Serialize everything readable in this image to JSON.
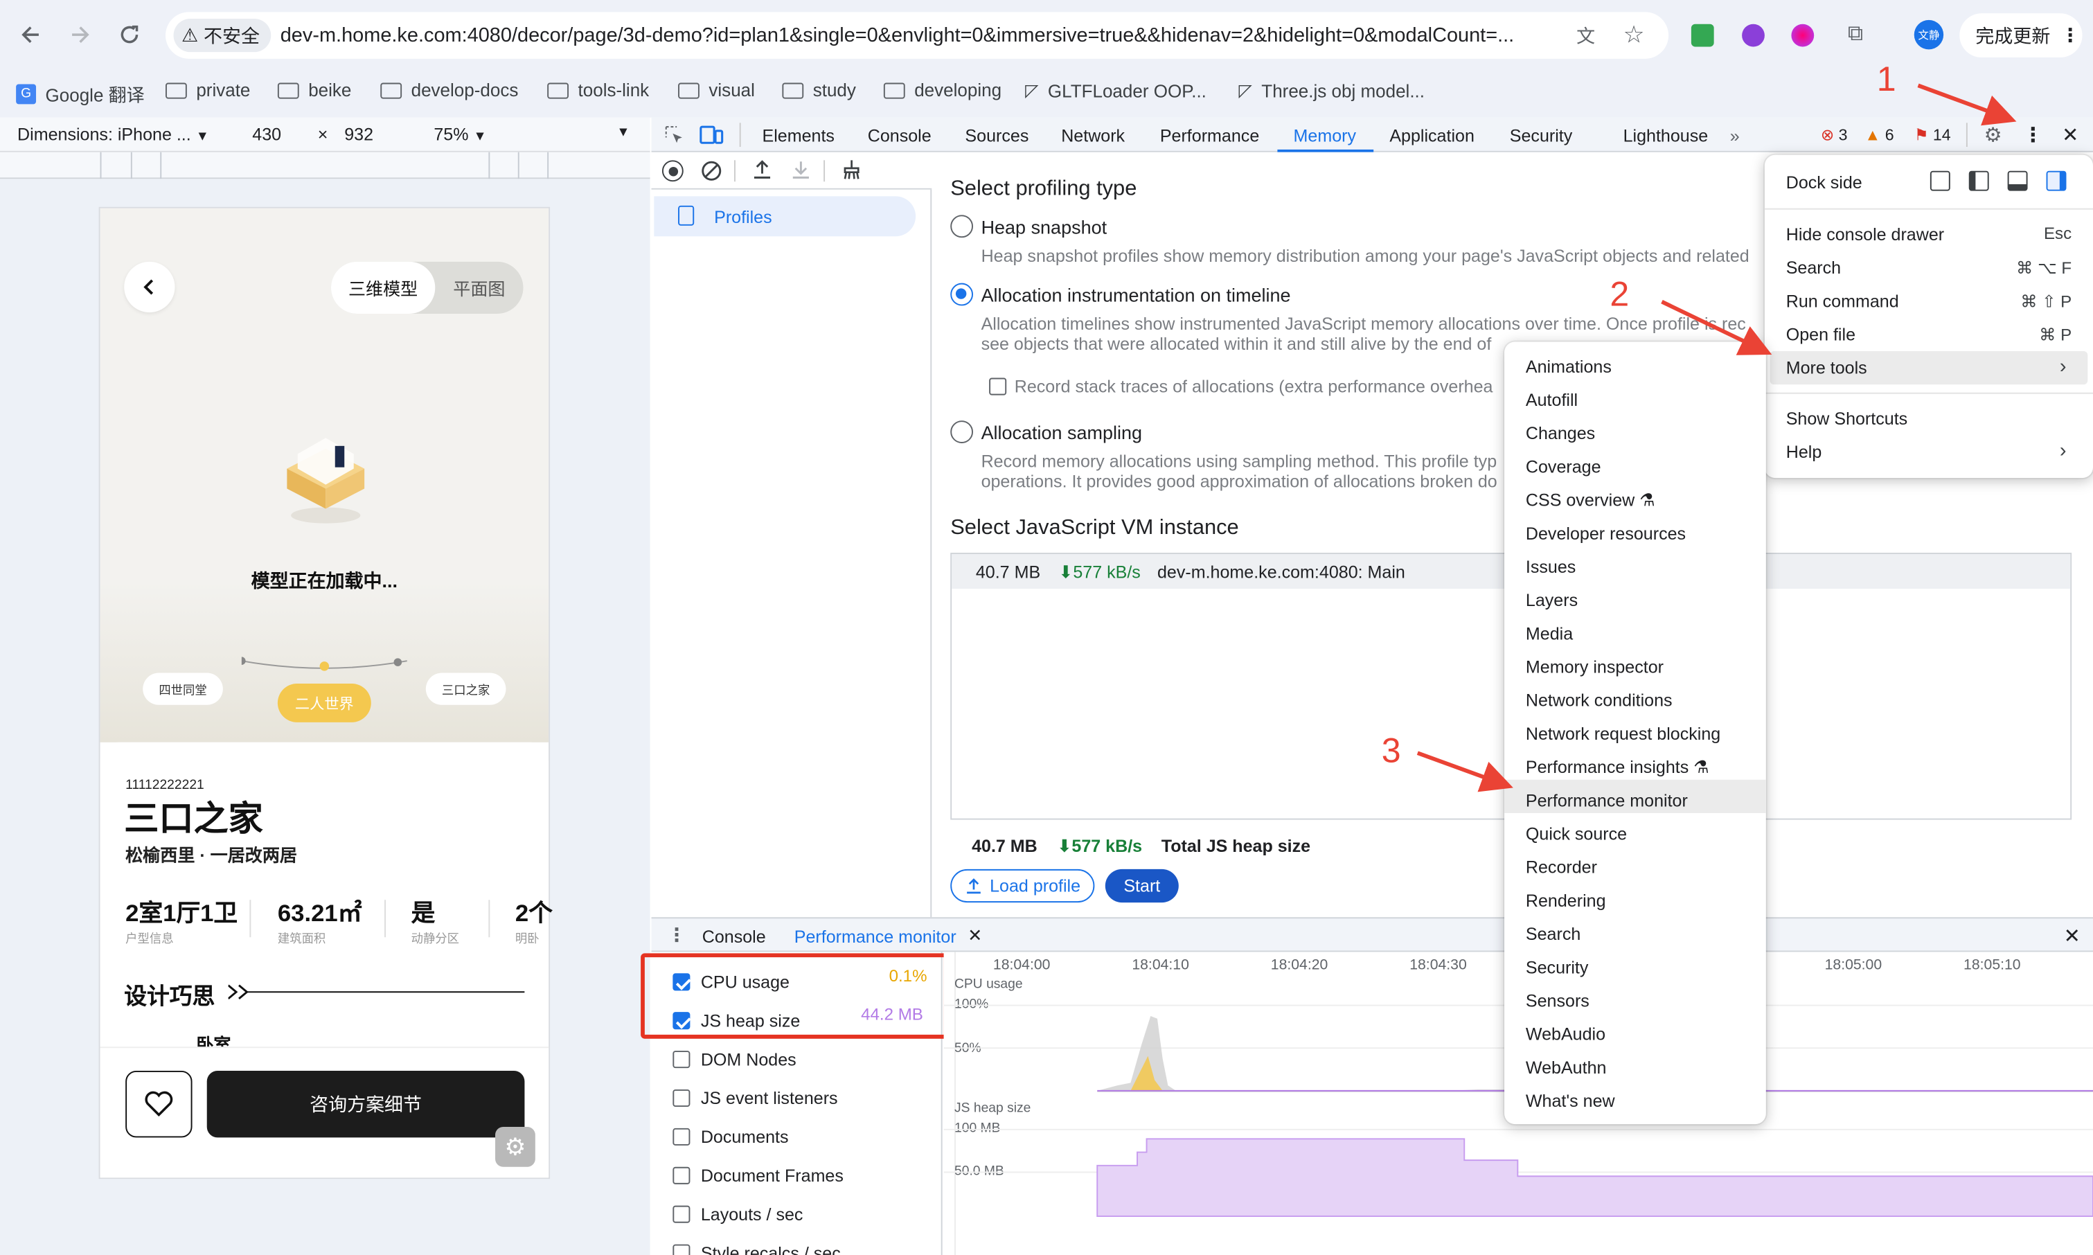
{
  "browser": {
    "url_insecure": "不安全",
    "url": "dev-m.home.ke.com:4080/decor/page/3d-demo?id=plan1&single=0&envlight=0&immersive=true&&hidenav=2&hidelight=0&modalCount=...",
    "update_button": "完成更新",
    "profile_initials": "文静",
    "bookmarks": [
      "Google 翻译",
      "private",
      "beike",
      "develop-docs",
      "tools-link",
      "visual",
      "study",
      "developing",
      "GLTFLoader OOP...",
      "Three.js obj model..."
    ]
  },
  "device_toolbar": {
    "dimensions": "Dimensions: iPhone ...",
    "width": "430",
    "times": "×",
    "height": "932",
    "zoom": "75%"
  },
  "phone": {
    "tab_3d": "三维模型",
    "tab_plan": "平面图",
    "loading": "模型正在加载中...",
    "slider_left": "四世同堂",
    "slider_mid": "二人世界",
    "slider_right": "三口之家",
    "code": "11112222221",
    "title": "三口之家",
    "subtitle": "松榆西里 · 一居改两居",
    "stats": [
      {
        "value": "2室1厅1卫",
        "label": "户型信息"
      },
      {
        "value": "63.21㎡",
        "label": "建筑面积"
      },
      {
        "value": "是",
        "label": "动静分区"
      },
      {
        "value": "2个",
        "label": "明卧"
      }
    ],
    "section_title": "设计巧思",
    "room": "卧室",
    "consult": "咨询方案细节"
  },
  "devtools": {
    "tabs": [
      "Elements",
      "Console",
      "Sources",
      "Network",
      "Performance",
      "Memory",
      "Application",
      "Security",
      "Lighthouse"
    ],
    "active_tab": "Memory",
    "errors": "3",
    "warnings": "6",
    "issues": "14",
    "sidebar_profiles": "Profiles",
    "select_type": "Select profiling type",
    "heap_snapshot": "Heap snapshot",
    "heap_snapshot_desc": "Heap snapshot profiles show memory distribution among your page's JavaScript objects and related",
    "alloc_timeline": "Allocation instrumentation on timeline",
    "alloc_timeline_desc1": "Allocation timelines show instrumented JavaScript memory allocations over time. Once profile is rec",
    "alloc_timeline_desc2": "see objects that were allocated within it and still alive by the end of",
    "record_stack": "Record stack traces of allocations (extra performance overhea",
    "alloc_sampling": "Allocation sampling",
    "alloc_sampling_desc1": "Record memory allocations using sampling method. This profile typ",
    "alloc_sampling_desc2": "operations. It provides good approximation of allocations broken do",
    "vm_title": "Select JavaScript VM instance",
    "vm_size": "40.7 MB",
    "vm_rate": "⬇577 kB/s",
    "vm_name": "dev-m.home.ke.com:4080: Main",
    "total_size": "40.7 MB",
    "total_rate": "⬇577 kB/s",
    "total_label": "Total JS heap size",
    "load_profile": "Load profile",
    "start": "Start"
  },
  "drawer": {
    "console_tab": "Console",
    "pm_tab": "Performance monitor",
    "metrics": [
      {
        "label": "CPU usage",
        "checked": true,
        "value": "0.1%"
      },
      {
        "label": "JS heap size",
        "checked": true,
        "value": "44.2 MB"
      },
      {
        "label": "DOM Nodes",
        "checked": false,
        "value": ""
      },
      {
        "label": "JS event listeners",
        "checked": false,
        "value": ""
      },
      {
        "label": "Documents",
        "checked": false,
        "value": ""
      },
      {
        "label": "Document Frames",
        "checked": false,
        "value": ""
      },
      {
        "label": "Layouts / sec",
        "checked": false,
        "value": ""
      },
      {
        "label": "Style recalcs / sec",
        "checked": false,
        "value": ""
      }
    ],
    "times": [
      "18:04:00",
      "18:04:10",
      "18:04:20",
      "18:04:30",
      "18:05:00",
      "18:05:10"
    ],
    "cpu_label": "CPU usage",
    "cpu_100": "100%",
    "cpu_50": "50%",
    "heap_label": "JS heap size",
    "heap_100": "100 MB",
    "heap_50": "50.0 MB"
  },
  "settings_menu": {
    "dock_side": "Dock side",
    "items": [
      {
        "label": "Hide console drawer",
        "shortcut": "Esc"
      },
      {
        "label": "Search",
        "shortcut": "⌘ ⌥ F"
      },
      {
        "label": "Run command",
        "shortcut": "⌘ ⇧ P"
      },
      {
        "label": "Open file",
        "shortcut": "⌘ P"
      },
      {
        "label": "More tools",
        "shortcut": "›"
      },
      {
        "label": "Show Shortcuts",
        "shortcut": ""
      },
      {
        "label": "Help",
        "shortcut": "›"
      }
    ]
  },
  "more_tools": [
    "Animations",
    "Autofill",
    "Changes",
    "Coverage",
    "CSS overview",
    "Developer resources",
    "Issues",
    "Layers",
    "Media",
    "Memory inspector",
    "Network conditions",
    "Network request blocking",
    "Performance insights",
    "Performance monitor",
    "Quick source",
    "Recorder",
    "Rendering",
    "Search",
    "Security",
    "Sensors",
    "WebAudio",
    "WebAuthn",
    "What's new"
  ],
  "annotations": [
    "1",
    "2",
    "3"
  ],
  "colors": {
    "accent": "#1a73e8",
    "annotation": "#ea4335",
    "cpu": "#f5c542",
    "heap": "#b27ae6",
    "mid_slider": "#f4c84f"
  }
}
